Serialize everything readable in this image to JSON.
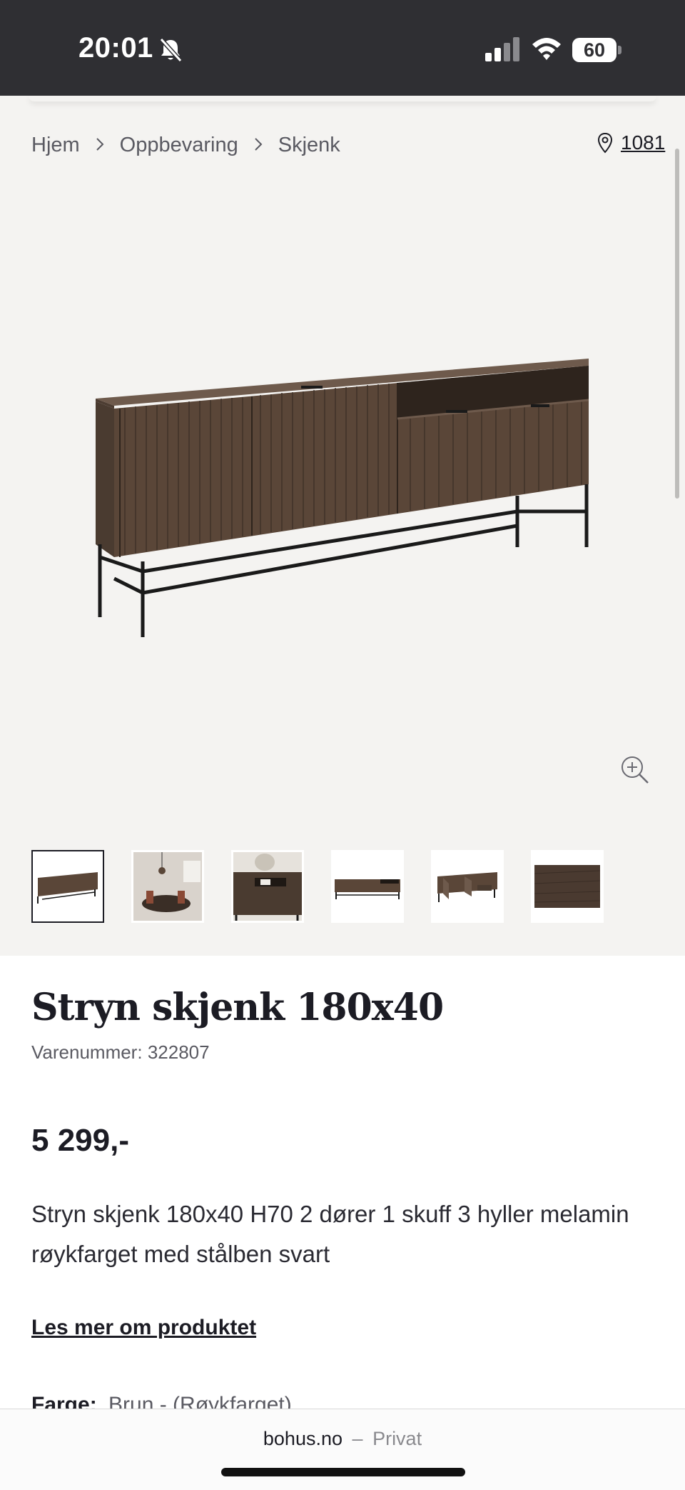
{
  "status_bar": {
    "time": "20:01",
    "battery": "60",
    "icons": [
      "bell-slash-icon",
      "signal-icon",
      "wifi-icon",
      "battery-icon"
    ]
  },
  "breadcrumb": {
    "items": [
      "Hjem",
      "Oppbevaring",
      "Skjenk"
    ]
  },
  "store": {
    "code": "1081",
    "icon": "map-pin-icon"
  },
  "gallery": {
    "zoom_icon": "zoom-in-icon",
    "thumbnail_count": 6,
    "selected_thumbnail": 1
  },
  "product": {
    "title": "Stryn skjenk 180x40",
    "sku_label": "Varenummer:",
    "sku": "322807",
    "price": "5 299,-",
    "description": "Stryn skjenk 180x40 H70 2 dører 1 skuff 3 hyller melamin røykfarget med stålben svart",
    "read_more": "Les mer om produktet",
    "color_label": "Farge:",
    "color_value": "Brun - (Røykfarget)"
  },
  "browser": {
    "domain": "bohus.no",
    "separator": "–",
    "mode": "Privat"
  },
  "colors": {
    "status_bar": "#2f2f33",
    "gallery_bg": "#f4f3f1",
    "text": "#1c1c24",
    "muted": "#5a5a62",
    "wood": "#5a4638"
  }
}
